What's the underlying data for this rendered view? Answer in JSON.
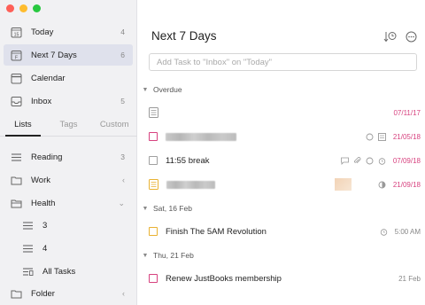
{
  "sidebar": {
    "smart_lists": [
      {
        "label": "Today",
        "count": "4",
        "icon": "calendar-day-icon",
        "day": "15"
      },
      {
        "label": "Next 7 Days",
        "count": "6",
        "icon": "calendar-week-icon",
        "day": "F"
      },
      {
        "label": "Calendar",
        "count": "",
        "icon": "calendar-icon"
      },
      {
        "label": "Inbox",
        "count": "5",
        "icon": "inbox-icon"
      }
    ],
    "tabs": [
      {
        "label": "Lists",
        "active": true
      },
      {
        "label": "Tags",
        "active": false
      },
      {
        "label": "Custom",
        "active": false
      }
    ],
    "lists": [
      {
        "label": "Reading",
        "count": "3",
        "icon": "list-icon"
      },
      {
        "label": "Work",
        "chevron": "‹",
        "icon": "folder-icon"
      },
      {
        "label": "Health",
        "chevron": "⌄",
        "icon": "folder-open-icon"
      },
      {
        "label": "3",
        "icon": "list-icon"
      },
      {
        "label": "4",
        "icon": "list-icon"
      },
      {
        "label": "All Tasks",
        "icon": "all-tasks-icon"
      },
      {
        "label": "Folder",
        "chevron": "‹",
        "icon": "folder-icon"
      }
    ]
  },
  "main": {
    "title": "Next 7 Days",
    "add_placeholder": "Add Task to \"Inbox\" on \"Today\"",
    "header_icons": [
      "sort-by-time-icon",
      "more-options-icon"
    ],
    "sections": [
      {
        "label": "Overdue"
      },
      {
        "label": "Sat, 16 Feb"
      },
      {
        "label": "Thu, 21 Feb"
      }
    ],
    "tasks": [
      {
        "title": "",
        "due": "07/11/17",
        "checkbox": "note",
        "blurred": false
      },
      {
        "title": "",
        "due": "21/05/18",
        "checkbox": "pink",
        "blurred": true
      },
      {
        "title": "11:55 break",
        "due": "07/09/18",
        "checkbox": "gray",
        "blurred": false
      },
      {
        "title": "",
        "due": "21/09/18",
        "checkbox": "yellow-note",
        "blurred": true
      },
      {
        "title": "Finish The 5AM Revolution",
        "due": "5:00 AM",
        "checkbox": "yellow",
        "blurred": false
      },
      {
        "title": "Renew JustBooks membership",
        "due": "21 Feb",
        "checkbox": "pink",
        "blurred": false
      }
    ]
  },
  "colors": {
    "accent": "#d7427f",
    "selected_bg": "#dfe1ec",
    "sidebar_bg": "#f1f1f3",
    "priority_medium": "#e9b232"
  }
}
